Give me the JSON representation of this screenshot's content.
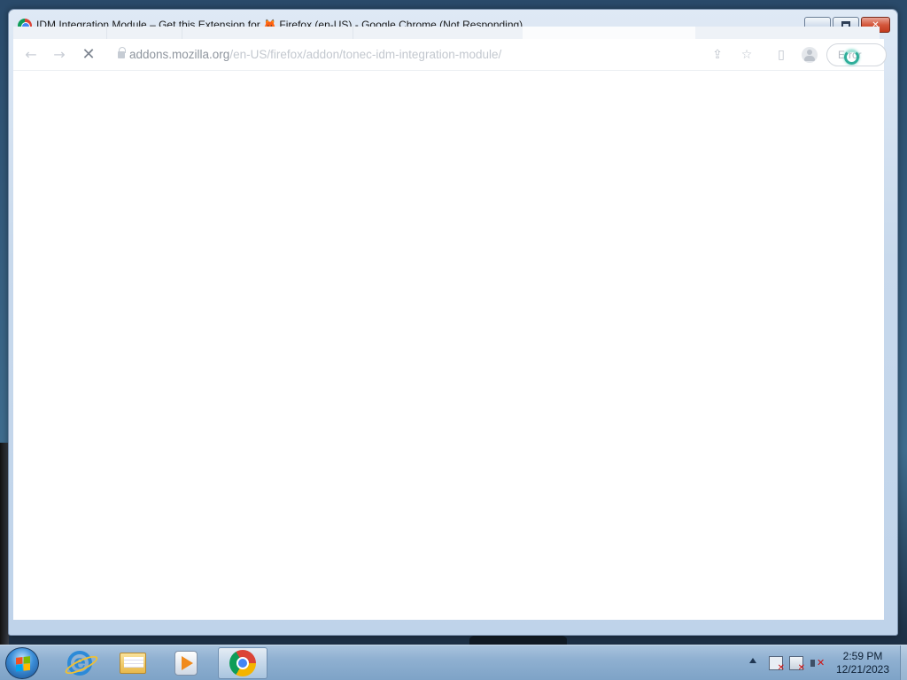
{
  "window": {
    "title": "IDM Integration Module – Get this Extension for 🦊 Firefox (en-US) - Google Chrome (Not Responding)"
  },
  "toolbar": {
    "back_icon": "back-arrow-icon",
    "forward_icon": "forward-arrow-icon",
    "stop_icon": "stop-x-icon",
    "address_host": "addons.mozilla.org",
    "address_path": "/en-US/firefox/addon/tonec-idm-integration-module/",
    "error_label": "Error"
  },
  "taskbar": {
    "apps": [
      "Internet Explorer",
      "Windows Explorer",
      "Windows Media Player",
      "Google Chrome"
    ],
    "active_app": "Google Chrome"
  },
  "clock": {
    "time": "2:59 PM",
    "date": "12/21/2023"
  },
  "colors": {
    "busy_cursor": "#2fae9a",
    "taskbar": "#8fb0d1"
  }
}
